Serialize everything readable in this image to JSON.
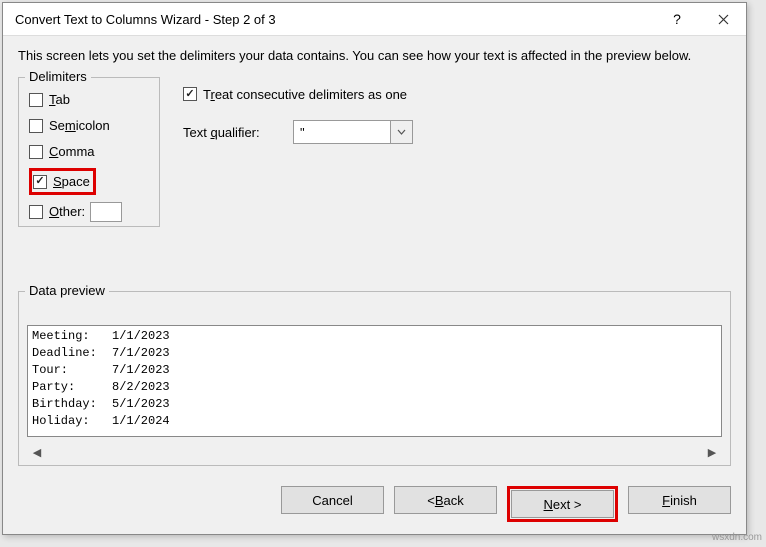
{
  "titlebar": {
    "title": "Convert Text to Columns Wizard - Step 2 of 3"
  },
  "description": "This screen lets you set the delimiters your data contains.  You can see how your text is affected in the preview below.",
  "delimiters": {
    "legend": "Delimiters",
    "tab": "Tab",
    "semicolon": "Semicolon",
    "comma": "Comma",
    "space": "Space",
    "other": "Other:",
    "other_value": ""
  },
  "options": {
    "treat_consecutive": "Treat consecutive delimiters as one",
    "qualifier_label": "Text qualifier:",
    "qualifier_value": "\""
  },
  "preview": {
    "legend": "Data preview",
    "rows": [
      {
        "c1": "Meeting:",
        "c2": "1/1/2023"
      },
      {
        "c1": "Deadline:",
        "c2": "7/1/2023"
      },
      {
        "c1": "Tour:",
        "c2": "7/1/2023"
      },
      {
        "c1": "Party:",
        "c2": "8/2/2023"
      },
      {
        "c1": "Birthday:",
        "c2": "5/1/2023"
      },
      {
        "c1": "Holiday:",
        "c2": "1/1/2024"
      }
    ]
  },
  "buttons": {
    "cancel": "Cancel",
    "back": "< Back",
    "next": "Next >",
    "finish": "Finish"
  },
  "watermark": "wsxdn.com"
}
